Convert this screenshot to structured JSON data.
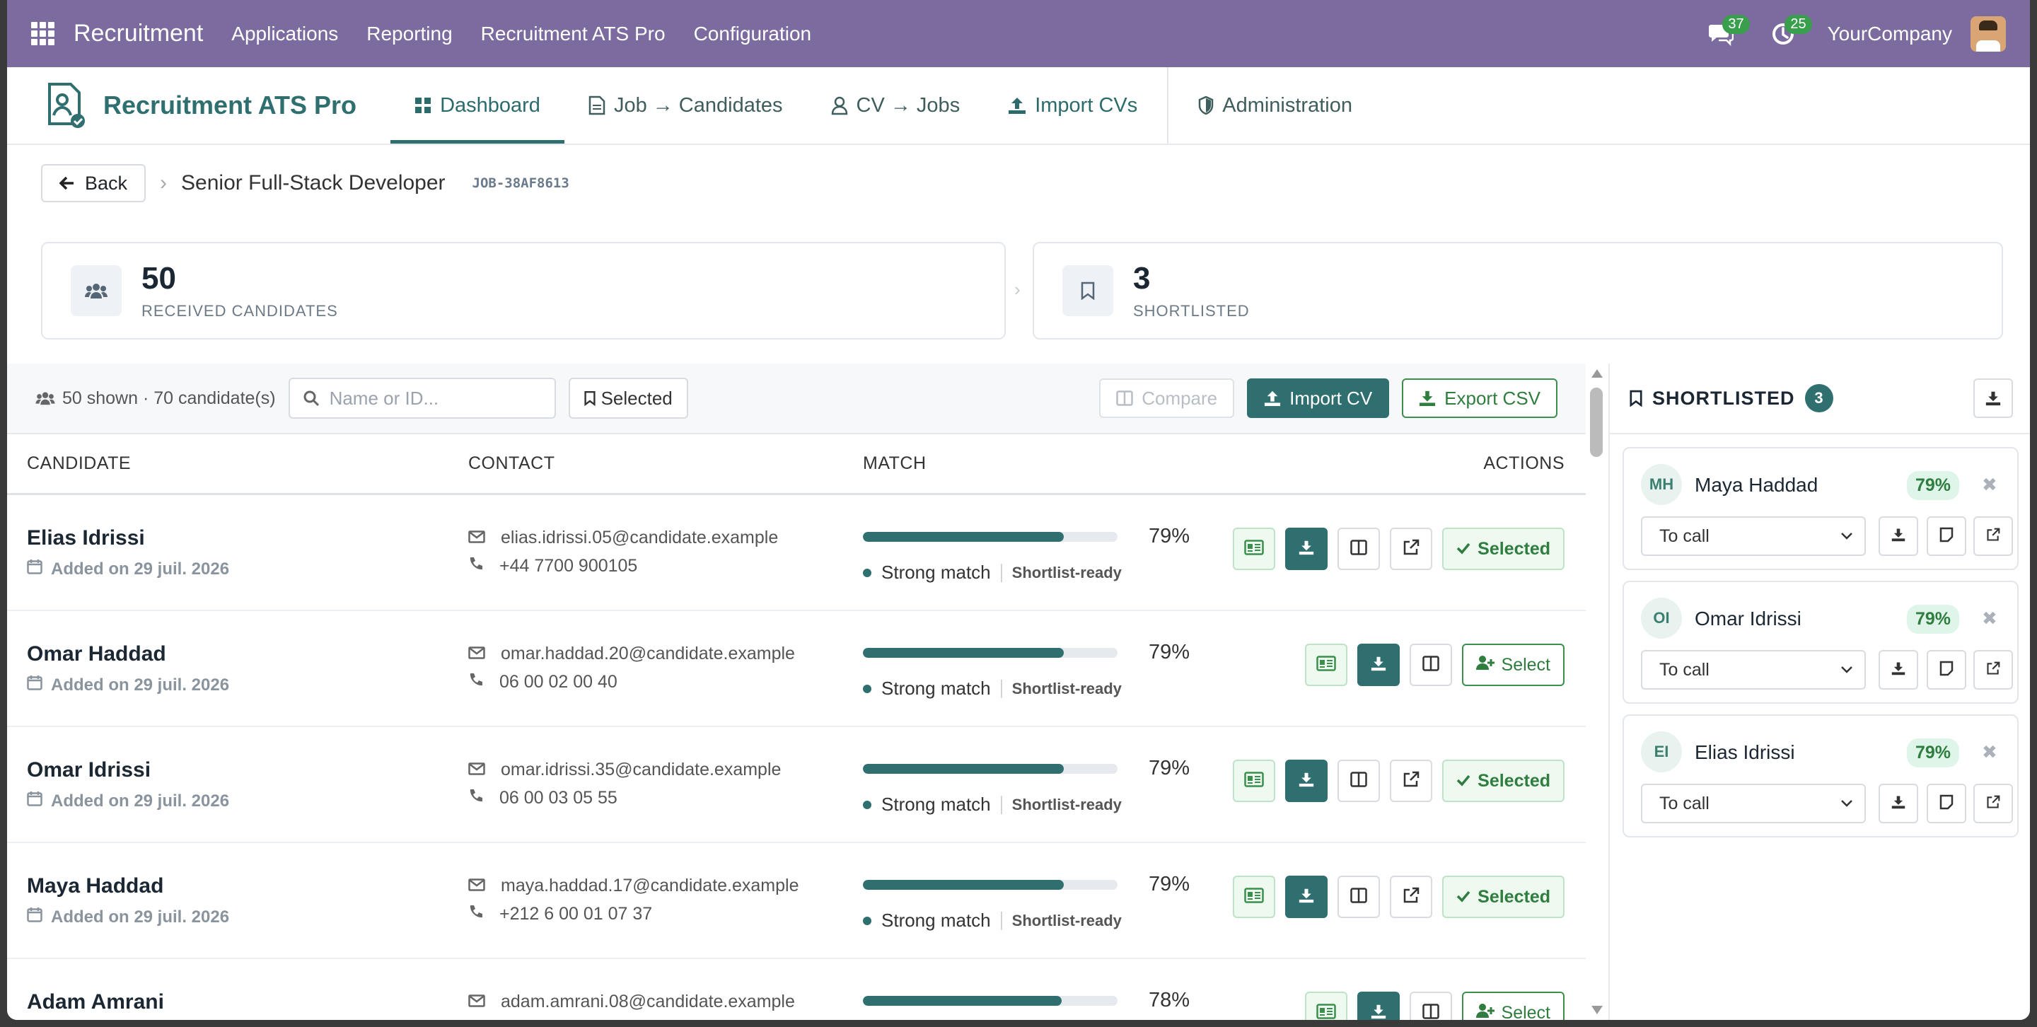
{
  "topbar": {
    "app_name": "Recruitment",
    "menu": [
      "Applications",
      "Reporting",
      "Recruitment ATS Pro",
      "Configuration"
    ],
    "messages_count": "37",
    "activities_count": "25",
    "company": "YourCompany"
  },
  "module": {
    "title": "Recruitment ATS Pro",
    "tabs": [
      {
        "label": "Dashboard",
        "icon": "dashboard-icon",
        "active": true
      },
      {
        "label": "Job → Candidates",
        "icon": "file-icon"
      },
      {
        "label": "CV → Jobs",
        "icon": "user-icon"
      },
      {
        "label": "Import CVs",
        "icon": "upload-icon"
      },
      {
        "label": "Administration",
        "icon": "shield-icon"
      }
    ]
  },
  "breadcrumb": {
    "back_label": "Back",
    "job_title": "Senior Full-Stack Developer",
    "job_id": "JOB-38AF8613"
  },
  "stats": [
    {
      "value": "50",
      "label": "RECEIVED CANDIDATES",
      "icon": "users-icon"
    },
    {
      "value": "3",
      "label": "SHORTLISTED",
      "icon": "bookmark-icon"
    }
  ],
  "toolbar": {
    "shown_text": "50 shown · 70 candidate(s)",
    "search_placeholder": "Name or ID...",
    "selected_filter": "Selected",
    "compare_label": "Compare",
    "import_label": "Import CV",
    "export_label": "Export CSV"
  },
  "table": {
    "headers": [
      "CANDIDATE",
      "CONTACT",
      "MATCH",
      "ACTIONS"
    ],
    "rows": [
      {
        "name": "Elias Idrissi",
        "added": "Added on 29 juil. 2026",
        "email": "elias.idrissi.05@candidate.example",
        "phone": "+44 7700 900105",
        "match": 79,
        "match_text": "79%",
        "match_label": "Strong match",
        "tag": "Shortlist-ready",
        "status": "Selected"
      },
      {
        "name": "Omar Haddad",
        "added": "Added on 29 juil. 2026",
        "email": "omar.haddad.20@candidate.example",
        "phone": "06 00 02 00 40",
        "match": 79,
        "match_text": "79%",
        "match_label": "Strong match",
        "tag": "Shortlist-ready",
        "status": "Select"
      },
      {
        "name": "Omar Idrissi",
        "added": "Added on 29 juil. 2026",
        "email": "omar.idrissi.35@candidate.example",
        "phone": "06 00 03 05 55",
        "match": 79,
        "match_text": "79%",
        "match_label": "Strong match",
        "tag": "Shortlist-ready",
        "status": "Selected"
      },
      {
        "name": "Maya Haddad",
        "added": "Added on 29 juil. 2026",
        "email": "maya.haddad.17@candidate.example",
        "phone": "+212 6 00 01 07 37",
        "match": 79,
        "match_text": "79%",
        "match_label": "Strong match",
        "tag": "Shortlist-ready",
        "status": "Selected"
      },
      {
        "name": "Adam Amrani",
        "added": "",
        "email": "adam.amrani.08@candidate.example",
        "phone": "",
        "match": 78,
        "match_text": "78%",
        "match_label": "",
        "tag": "",
        "status": "Select"
      }
    ]
  },
  "shortlist": {
    "title": "SHORTLISTED",
    "count": "3",
    "items": [
      {
        "initials": "MH",
        "name": "Maya Haddad",
        "score": "79%",
        "stage": "To call"
      },
      {
        "initials": "OI",
        "name": "Omar Idrissi",
        "score": "79%",
        "stage": "To call"
      },
      {
        "initials": "EI",
        "name": "Elias Idrissi",
        "score": "79%",
        "stage": "To call"
      }
    ]
  },
  "colors": {
    "topbar": "#7c6b9e",
    "accent": "#2f6f6f",
    "success": "#3a9f4c"
  }
}
